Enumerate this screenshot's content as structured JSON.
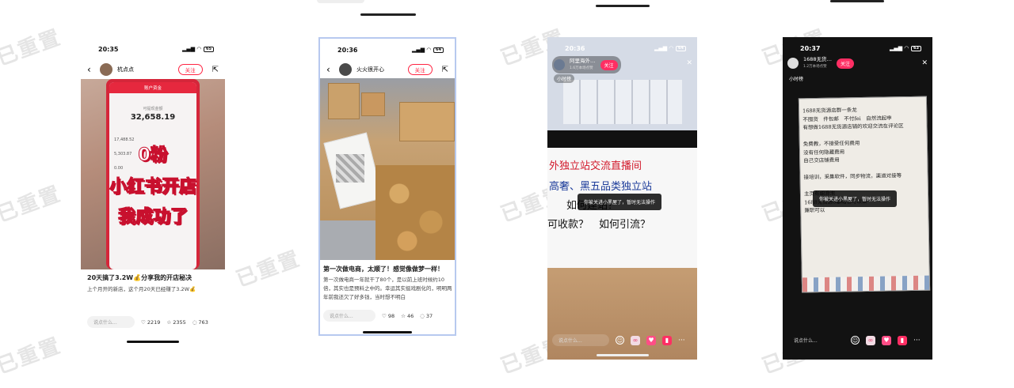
{
  "watermark": "已重置",
  "phone1": {
    "time": "20:35",
    "battery": "65",
    "author": "杭点点",
    "follow": "关注",
    "card_header": "账户资金",
    "balance_caption": "可提现金额",
    "balance": "32,658.19",
    "line_amounts": [
      "17,488.52",
      "5,303.87",
      "0.00"
    ],
    "overlay_line1": "0粉",
    "overlay_line2": "小红书开店",
    "overlay_line3": "我成功了",
    "title": "20天搞了3.2W💰分享我的开店秘决",
    "desc": "上个月开的新店，这个月20天已经赚了3.2W💰",
    "comment_placeholder": "说点什么...",
    "likes": "2219",
    "stars": "2355",
    "comments": "763"
  },
  "phone2": {
    "time": "20:36",
    "battery": "64",
    "author": "火火很开心",
    "follow": "关注",
    "title": "第一次做电商，太顺了！感觉像做梦一样！",
    "desc": "第一次做电商一年就干了80个，是以前上班时候约10倍，其实也是预料之中的。幸运其实挺戏剧化的，明明两年前我还欠了好多钱，当时想不明白",
    "comment_placeholder": "说点什么...",
    "likes": "98",
    "stars": "46",
    "comments": "37"
  },
  "phone3": {
    "time": "20:36",
    "battery": "64",
    "host": "阿里海外…",
    "host_sub": "1.6万本场点赞",
    "follow": "关注",
    "tag": "小时榜",
    "banner_line1": "外独立站交流直播间",
    "banner_line2": "高奢、黑五品类独立站",
    "banner_line3": "如何建站？",
    "banner_line4": "可收款？　如何引流？",
    "toast": "你被关进小黑屋了，暂时无法操作",
    "input_placeholder": "说点什么..."
  },
  "phone4": {
    "time": "20:37",
    "battery": "63",
    "host": "1688无货…",
    "host_sub": "1.2万本场点赞",
    "follow": "关注",
    "tag": "小时榜",
    "board_lines": [
      "1688无货源店群一条龙",
      "不囤货　件包邮　不付fei　自然流起申",
      "有想做1688无货源店铺的欢迎交流在评论区",
      "",
      "免费教，不接受任何费用",
      "没有任何隐藏费用",
      "自己交店铺费用",
      "",
      "接培训，采集软件，同步物流，渠道对接等",
      "",
      "主页有细滑泡",
      "1688无货源0基础也可以做",
      "兼职可以"
    ],
    "toast": "你被关进小黑屋了，暂时无法操作",
    "input_placeholder": "说点什么..."
  }
}
